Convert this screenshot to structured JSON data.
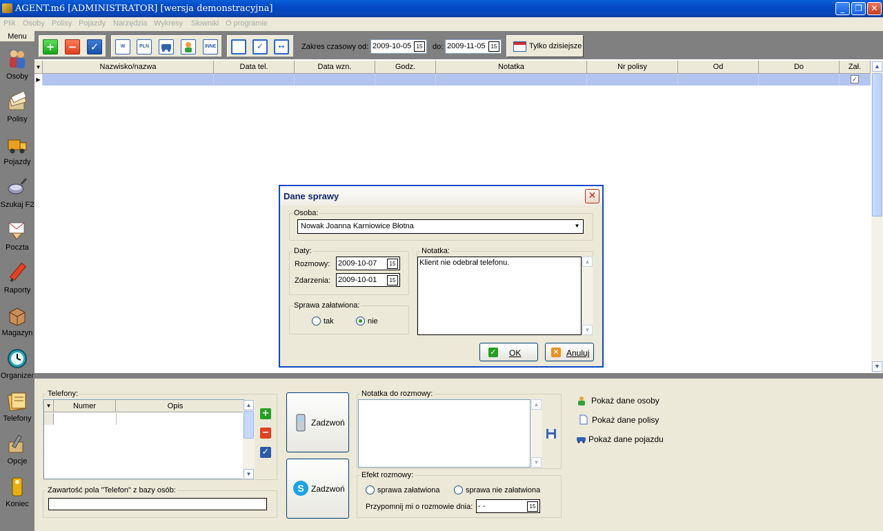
{
  "window": {
    "title": "AGENT.m6 [ADMINISTRATOR] [wersja demonstracyjna]",
    "minimize": "_",
    "restore": "❐",
    "close": "✕"
  },
  "menubar": {
    "items": [
      "Plik",
      "Osoby",
      "Polisy",
      "Pojazdy",
      "Narzędzia",
      "Wykresy",
      "Słowniki",
      "O programie"
    ]
  },
  "leftnav": {
    "header": "Menu",
    "items": [
      {
        "label": "Osoby",
        "icon": "people-icon"
      },
      {
        "label": "Polisy",
        "icon": "policy-stack-icon"
      },
      {
        "label": "Pojazdy",
        "icon": "truck-icon"
      },
      {
        "label": "Szukaj F2",
        "icon": "magnifier-icon"
      },
      {
        "label": "Poczta",
        "icon": "mail-icon"
      },
      {
        "label": "Raporty",
        "icon": "pencil-icon"
      },
      {
        "label": "Magazyn",
        "icon": "box-icon"
      },
      {
        "label": "Organizer",
        "icon": "clock-icon"
      },
      {
        "label": "Telefony",
        "icon": "phone-book-icon"
      },
      {
        "label": "Opcje",
        "icon": "tools-icon"
      },
      {
        "label": "Koniec",
        "icon": "exit-icon"
      }
    ]
  },
  "toolbar": {
    "add": "+",
    "remove": "−",
    "confirm": "✓",
    "filter_w": "W",
    "filter_pln": "PLN",
    "filter_inne": "INNE",
    "range_from_label": "Zakres czasowy od:",
    "range_from": "2009-10-05",
    "range_to_label": "do:",
    "range_to": "2009-11-05",
    "calendar_glyph": "15",
    "today_button": "Tylko dzisiejsze"
  },
  "grid": {
    "columns": [
      "Nazwisko/nazwa",
      "Data tel.",
      "Data wzn.",
      "Godz.",
      "Notatka",
      "Nr polisy",
      "Od",
      "Do",
      "Zał."
    ],
    "row_checkbox": "✓",
    "row_marker": "▶",
    "head_marker": "▼"
  },
  "dialog": {
    "title": "Dane sprawy",
    "close": "✕",
    "osoba_legend": "Osoba:",
    "osoba_value": "Nowak Joanna  Karniowice  Błotna",
    "daty_legend": "Daty:",
    "rozmowy_label": "Rozmowy:",
    "rozmowy_value": "2009-10-07",
    "zdarzenia_label": "Zdarzenia:",
    "zdarzenia_value": "2009-10-01",
    "sprawa_legend": "Sprawa załatwiona:",
    "option_tak": "tak",
    "option_nie": "nie",
    "selected": "nie",
    "notatka_legend": "Notatka:",
    "notatka_value": "Klient nie odebrał telefonu.",
    "ok": "OK",
    "cancel": "Anuluj"
  },
  "bottom": {
    "telefony_legend": "Telefony:",
    "col_numer": "Numer",
    "col_opis": "Opis",
    "zawartosc_legend": "Zawartość pola \"Telefon\" z bazy osób:",
    "zawartosc_value": "",
    "call_button_1": "Zadzwoń",
    "call_button_2": "Zadzwoń",
    "notatka_legend": "Notatka do rozmowy:",
    "notatka_value": "",
    "efekt_legend": "Efekt rozmowy:",
    "efekt_option_1": "sprawa załatwiona",
    "efekt_option_2": "sprawa nie załatwiona",
    "przypomnij_label": "Przypomnij mi o rozmowie dnia:",
    "przypomnij_value": " - -",
    "links": [
      "Pokaż dane osoby",
      "Pokaż dane polisy",
      "Pokaż dane pojazdu"
    ]
  },
  "colors": {
    "titlebar": "#0348c5",
    "selected_row": "#b3c4ee",
    "dialog_border": "#0a48c8",
    "radio_selected": "#21a121"
  }
}
